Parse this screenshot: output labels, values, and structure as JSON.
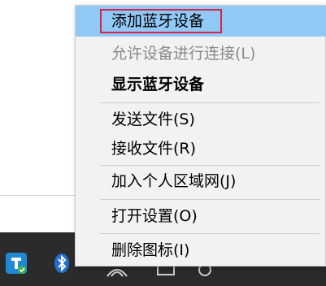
{
  "menu": {
    "items": [
      {
        "label": "添加蓝牙设备",
        "state": "highlighted"
      },
      {
        "label": "允许设备进行连接(L)",
        "state": "disabled"
      },
      {
        "label": "显示蓝牙设备",
        "state": "default-bold"
      },
      {
        "label": "发送文件(S)",
        "state": "normal"
      },
      {
        "label": "接收文件(R)",
        "state": "normal"
      },
      {
        "label": "加入个人区域网(J)",
        "state": "normal"
      },
      {
        "label": "打开设置(O)",
        "state": "normal"
      },
      {
        "label": "删除图标(I)",
        "state": "normal"
      }
    ]
  },
  "taskbar": {
    "icons": [
      "shield-check-icon",
      "bluetooth-icon",
      "network-icon",
      "monitor-icon",
      "settings-icon"
    ]
  },
  "colors": {
    "menu_bg": "#f2f2f2",
    "highlight": "#90c8f6",
    "focus_border": "#d6254a",
    "taskbar": "#2b2b2b"
  }
}
